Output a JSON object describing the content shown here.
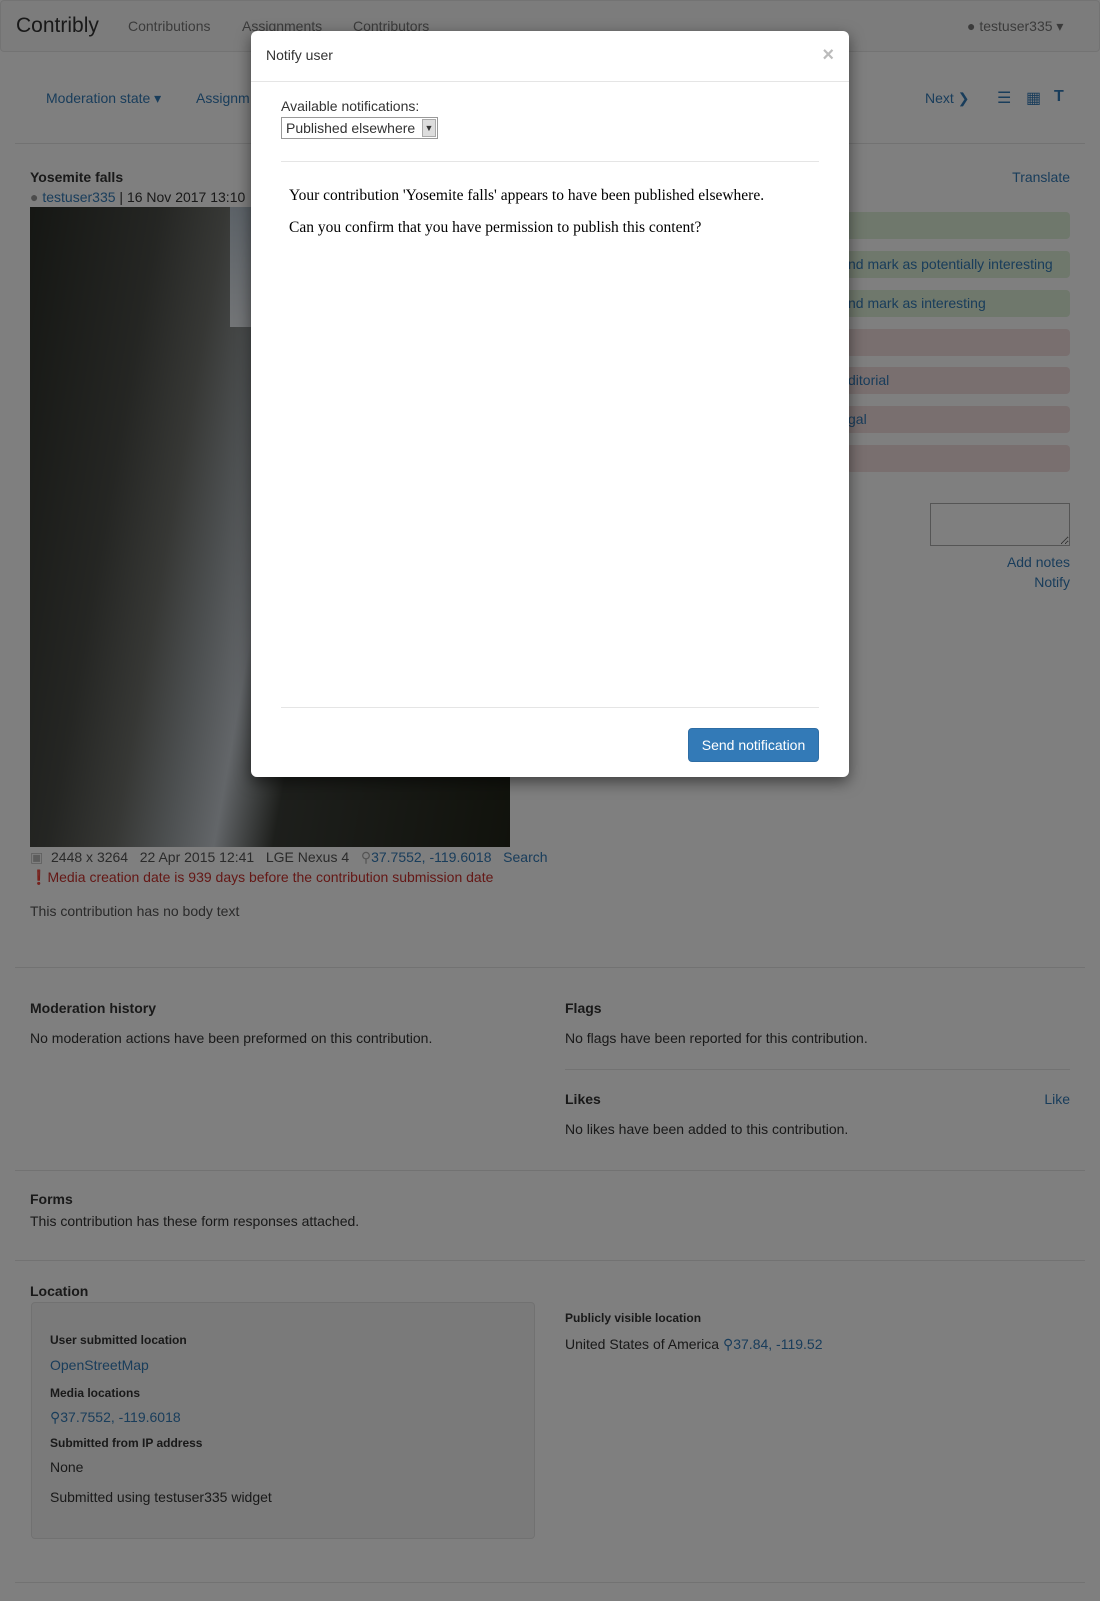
{
  "navbar": {
    "brand": "Contribly",
    "links": [
      "Contributions",
      "Assignments",
      "Contributors"
    ],
    "user": "testuser335"
  },
  "subnav": {
    "moderation_state": "Moderation state",
    "assignments_partial": "Assignm",
    "next": "Next"
  },
  "contribution": {
    "title": "Yosemite falls",
    "author": "testuser335",
    "date": "16 Nov 2017 13:10",
    "translate": "Translate",
    "media": {
      "dimensions": "2448 x 3264",
      "created": "22 Apr 2015 12:41",
      "device": "LGE Nexus 4",
      "coords": "37.7552, -119.6018",
      "search": "Search"
    },
    "warning": "Media creation date is 939 days before the contribution submission date",
    "body": "This contribution has no body text"
  },
  "moderation_buttons": [
    {
      "label": "",
      "color": "green"
    },
    {
      "label": "nd mark as potentially interesting",
      "color": "green"
    },
    {
      "label": "nd mark as interesting",
      "color": "green"
    },
    {
      "label": "",
      "color": "red"
    },
    {
      "label": "ditorial",
      "color": "red"
    },
    {
      "label": "gal",
      "color": "red"
    },
    {
      "label": "",
      "color": "red"
    }
  ],
  "notes": {
    "add_notes": "Add notes",
    "notify": "Notify"
  },
  "history": {
    "title": "Moderation history",
    "text": "No moderation actions have been preformed on this contribution."
  },
  "flags": {
    "title": "Flags",
    "text": "No flags have been reported for this contribution."
  },
  "likes": {
    "title": "Likes",
    "like": "Like",
    "text": "No likes have been added to this contribution."
  },
  "forms": {
    "title": "Forms",
    "text": "This contribution has these form responses attached."
  },
  "location": {
    "title": "Location",
    "user_submitted_label": "User submitted location",
    "osm": "OpenStreetMap",
    "media_label": "Media locations",
    "media_coords": "37.7552, -119.6018",
    "ip_label": "Submitted from IP address",
    "ip": "None",
    "widget": "Submitted using testuser335 widget",
    "public_label": "Publicly visible location",
    "public_country": "United States of America",
    "public_coords": "37.84, -119.52"
  },
  "modal": {
    "title": "Notify user",
    "close": "×",
    "select_label": "Available notifications:",
    "selected": "Published elsewhere",
    "message": [
      "Your contribution 'Yosemite falls' appears to have been published elsewhere.",
      "Can you confirm that you have permission to publish this content?"
    ],
    "send": "Send notification",
    "accent": "#337ab7"
  }
}
